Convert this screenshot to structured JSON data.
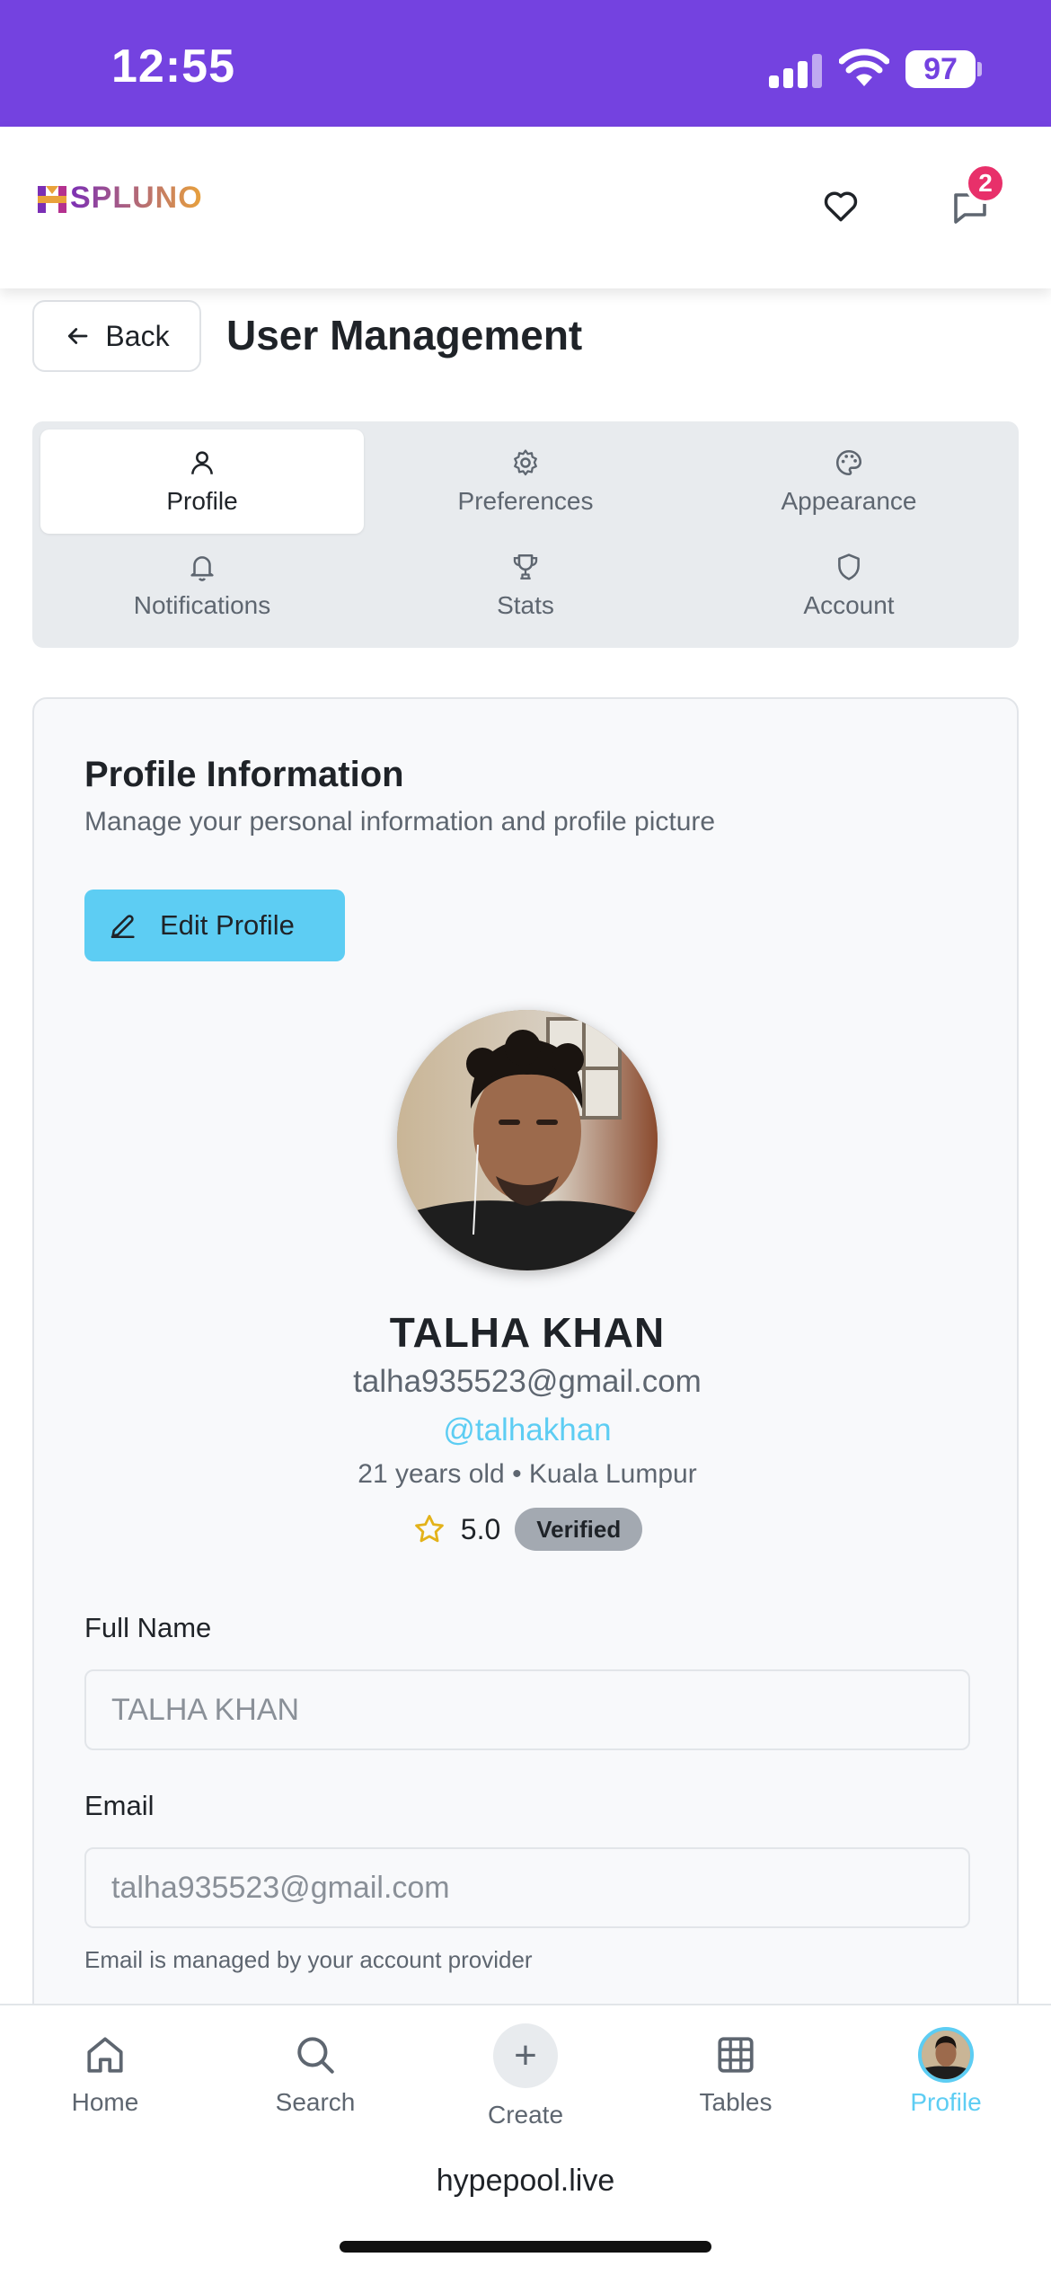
{
  "status_bar": {
    "time": "12:55",
    "battery": "97"
  },
  "header": {
    "logo_text": "SPLUNO",
    "chat_badge": "2"
  },
  "page": {
    "back_label": "Back",
    "title": "User Management"
  },
  "tabs": [
    {
      "label": "Profile",
      "icon": "user-icon",
      "active": true
    },
    {
      "label": "Preferences",
      "icon": "gear-icon",
      "active": false
    },
    {
      "label": "Appearance",
      "icon": "palette-icon",
      "active": false
    },
    {
      "label": "Notifications",
      "icon": "bell-icon",
      "active": false
    },
    {
      "label": "Stats",
      "icon": "trophy-icon",
      "active": false
    },
    {
      "label": "Account",
      "icon": "shield-icon",
      "active": false
    }
  ],
  "profile": {
    "section_title": "Profile Information",
    "section_subtitle": "Manage your personal information and profile picture",
    "edit_label": "Edit Profile",
    "name": "TALHA KHAN",
    "email": "talha935523@gmail.com",
    "username": "@talhakhan",
    "meta": "21 years old • Kuala Lumpur",
    "rating": "5.0",
    "verified_label": "Verified"
  },
  "form": {
    "full_name_label": "Full Name",
    "full_name_value": "TALHA KHAN",
    "email_label": "Email",
    "email_value": "talha935523@gmail.com",
    "email_hint": "Email is managed by your account provider"
  },
  "bottom_nav": [
    {
      "label": "Home",
      "icon": "home-icon",
      "active": false
    },
    {
      "label": "Search",
      "icon": "search-icon",
      "active": false
    },
    {
      "label": "Create",
      "icon": "plus-icon",
      "active": false
    },
    {
      "label": "Tables",
      "icon": "grid-icon",
      "active": false
    },
    {
      "label": "Profile",
      "icon": "avatar",
      "active": true
    }
  ],
  "browser": {
    "url": "hypepool.live"
  },
  "colors": {
    "status_bar": "#7442e0",
    "accent": "#5dcdf3",
    "badge": "#e8306a"
  }
}
